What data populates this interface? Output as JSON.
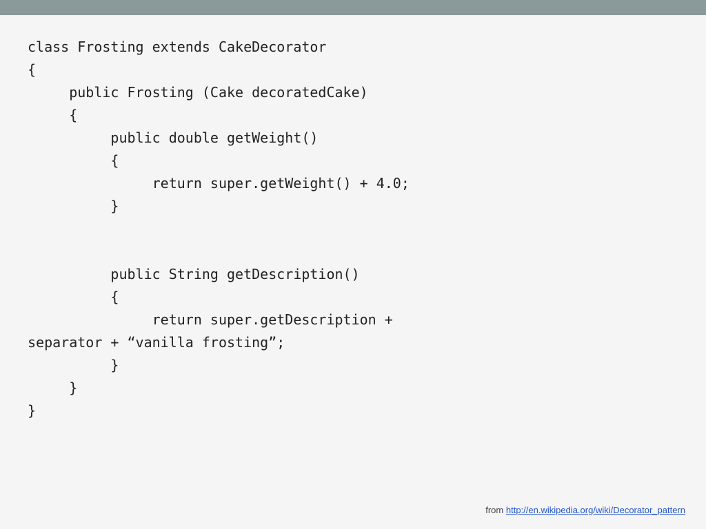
{
  "topbar": {
    "color": "#8a9a9a"
  },
  "code": {
    "lines": [
      "class Frosting extends CakeDecorator",
      "{",
      "     public Frosting (Cake decoratedCake)",
      "     {",
      "          public double getWeight()",
      "          {",
      "               return super.getWeight() + 4.0;",
      "          }",
      "",
      "",
      "          public String getDescription()",
      "          {",
      "               return super.getDescription +",
      "separator + “vanilla frosting”;",
      "          }",
      "     }",
      "}"
    ]
  },
  "footer": {
    "prefix": "from ",
    "link_text": "http://en.wikipedia.org/wiki/Decorator_pattern",
    "link_url": "http://en.wikipedia.org/wiki/Decorator_pattern"
  }
}
